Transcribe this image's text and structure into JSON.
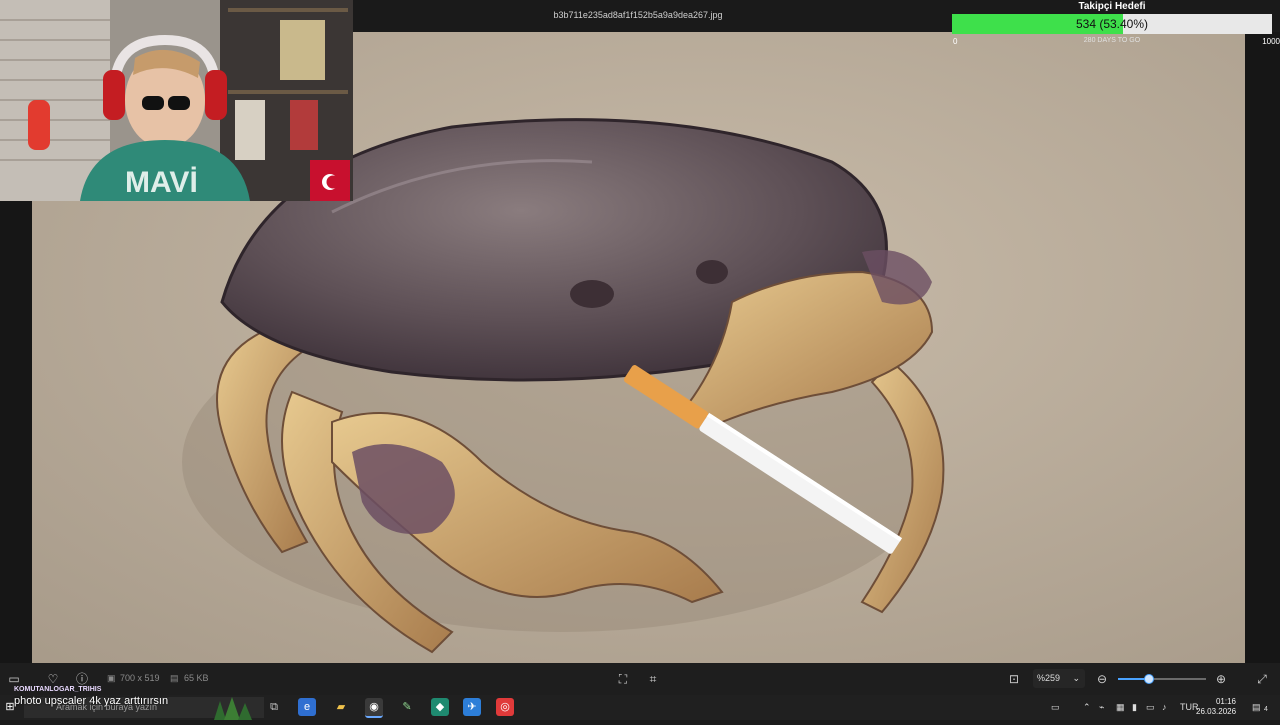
{
  "viewer": {
    "filename": "b3b711e235ad8af1f152b5a9a9dea267.jpg",
    "dimensions": "700 x 519",
    "filesize": "65 KB",
    "zoom": "%259",
    "zoom_slider_fraction": 0.35
  },
  "goal": {
    "title": "Takipçi Hedefi",
    "count": "534 (53.40%)",
    "progress_fraction": 0.534,
    "min": "0",
    "max": "1000",
    "days": "280 DAYS TO GO",
    "fill_color": "#3ee04b"
  },
  "chat": {
    "username": "KOMUTANLOGAR_TRIHIS",
    "message": "photo upscaler 4k yaz arttırırsın"
  },
  "taskbar": {
    "search_placeholder": "Aramak için buraya yazın",
    "language": "TUR",
    "time": "01:16",
    "date": "26.03.2026",
    "notification_count": "4"
  },
  "icons": {
    "left": [
      "display-icon",
      "heart-icon",
      "info-icon"
    ],
    "center": [
      "fit-screen-icon",
      "crop-icon"
    ],
    "right": [
      "actual-size-icon",
      "chevron-down-icon",
      "zoom-out-icon",
      "zoom-in-icon",
      "expand-icon"
    ]
  }
}
